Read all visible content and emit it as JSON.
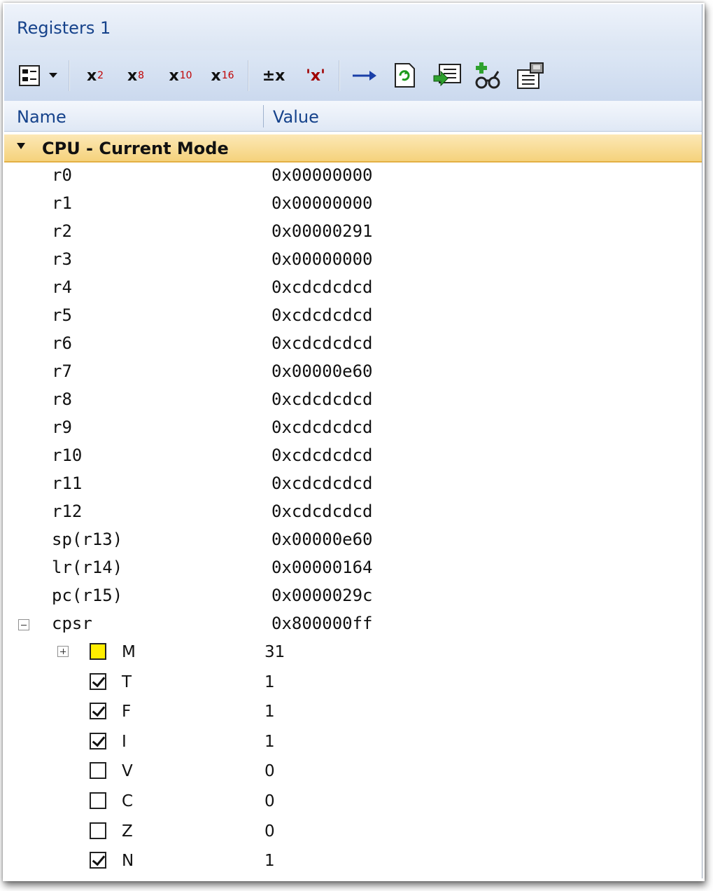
{
  "window": {
    "title": "Registers 1"
  },
  "toolbar": {
    "format_buttons": [
      {
        "base": "x",
        "sub": "2"
      },
      {
        "base": "x",
        "sub": "8"
      },
      {
        "base": "x",
        "sub": "10"
      },
      {
        "base": "x",
        "sub": "16"
      }
    ],
    "signed_label": "±x",
    "char_label": "'x'",
    "icons": [
      "display-options-icon",
      "dropdown-arrow-icon",
      "go-to-icon",
      "refresh-icon",
      "load-icon",
      "add-watch-icon",
      "properties-icon"
    ]
  },
  "columns": {
    "name": "Name",
    "value": "Value"
  },
  "group": {
    "label": "CPU - Current Mode"
  },
  "registers": [
    {
      "name": "r0",
      "value": "0x00000000"
    },
    {
      "name": "r1",
      "value": "0x00000000"
    },
    {
      "name": "r2",
      "value": "0x00000291"
    },
    {
      "name": "r3",
      "value": "0x00000000"
    },
    {
      "name": "r4",
      "value": "0xcdcdcdcd"
    },
    {
      "name": "r5",
      "value": "0xcdcdcdcd"
    },
    {
      "name": "r6",
      "value": "0xcdcdcdcd"
    },
    {
      "name": "r7",
      "value": "0x00000e60"
    },
    {
      "name": "r8",
      "value": "0xcdcdcdcd"
    },
    {
      "name": "r9",
      "value": "0xcdcdcdcd"
    },
    {
      "name": "r10",
      "value": "0xcdcdcdcd"
    },
    {
      "name": "r11",
      "value": "0xcdcdcdcd"
    },
    {
      "name": "r12",
      "value": "0xcdcdcdcd"
    },
    {
      "name": "sp(r13)",
      "value": "0x00000e60"
    },
    {
      "name": "lr(r14)",
      "value": "0x00000164"
    },
    {
      "name": "pc(r15)",
      "value": "0x0000029c"
    }
  ],
  "cpsr": {
    "name": "cpsr",
    "value": "0x800000ff",
    "flags": [
      {
        "name": "M",
        "value": "31",
        "state": "mode"
      },
      {
        "name": "T",
        "value": "1",
        "state": "checked"
      },
      {
        "name": "F",
        "value": "1",
        "state": "checked"
      },
      {
        "name": "I",
        "value": "1",
        "state": "checked"
      },
      {
        "name": "V",
        "value": "0",
        "state": "unchecked"
      },
      {
        "name": "C",
        "value": "0",
        "state": "unchecked"
      },
      {
        "name": "Z",
        "value": "0",
        "state": "unchecked"
      },
      {
        "name": "N",
        "value": "1",
        "state": "checked"
      }
    ]
  },
  "colors": {
    "title_text": "#15428b",
    "group_band": "#f5d27c",
    "mode_swatch": "#ffee00"
  }
}
